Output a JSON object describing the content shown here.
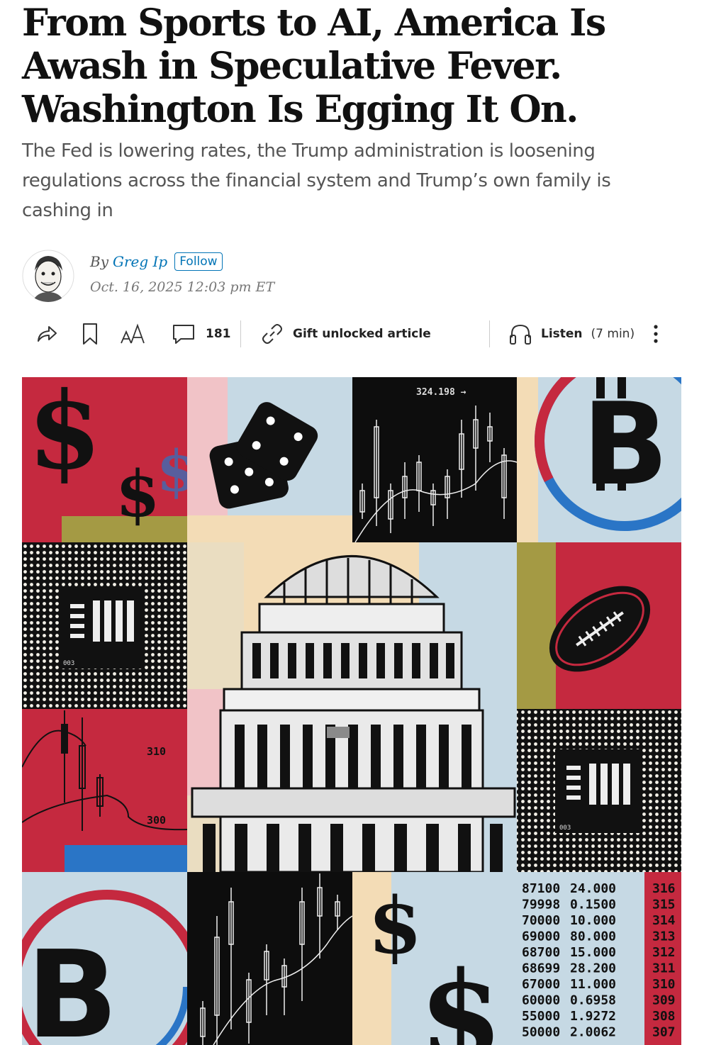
{
  "article": {
    "headline": "From Sports to AI, America Is Awash in Speculative Fever. Washington Is Egging It On.",
    "dek": "The Fed is lowering rates, the Trump administration is loosening regulations across the financial system and Trump’s own family is cashing in"
  },
  "byline": {
    "by": "By",
    "author": "Greg Ip",
    "follow": "Follow",
    "date": "Oct. 16, 2025 12:03 pm ET"
  },
  "toolbar": {
    "comment_count": "181",
    "gift_label": "Gift unlocked article",
    "listen_label": "Listen",
    "listen_duration": "(7 min)",
    "icons": [
      "share-icon",
      "bookmark-icon",
      "text-size-icon",
      "comment-icon",
      "link-icon",
      "headphones-icon",
      "more-icon"
    ]
  },
  "illustration": {
    "ticker_top": "324.198 →",
    "chip_label": "003",
    "chart_labels": [
      "310",
      "300"
    ],
    "table": [
      [
        "87100",
        "24.000",
        "316"
      ],
      [
        "79998",
        "0.1500",
        "315"
      ],
      [
        "70000",
        "10.000",
        "314"
      ],
      [
        "69000",
        "80.000",
        "313"
      ],
      [
        "68700",
        "15.000",
        "312"
      ],
      [
        "68699",
        "28.200",
        "311"
      ],
      [
        "67000",
        "11.000",
        "310"
      ],
      [
        "60000",
        "0.6958",
        "309"
      ],
      [
        "55000",
        "1.9272",
        "308"
      ],
      [
        "50000",
        "2.0062",
        "307"
      ]
    ],
    "colors": {
      "red": "#c5293f",
      "pale_blue": "#c6d9e4",
      "blue": "#2a75c6",
      "cream": "#f3dcb6",
      "pink": "#f1c3c7",
      "olive": "#a49a44",
      "black": "#111111"
    }
  }
}
